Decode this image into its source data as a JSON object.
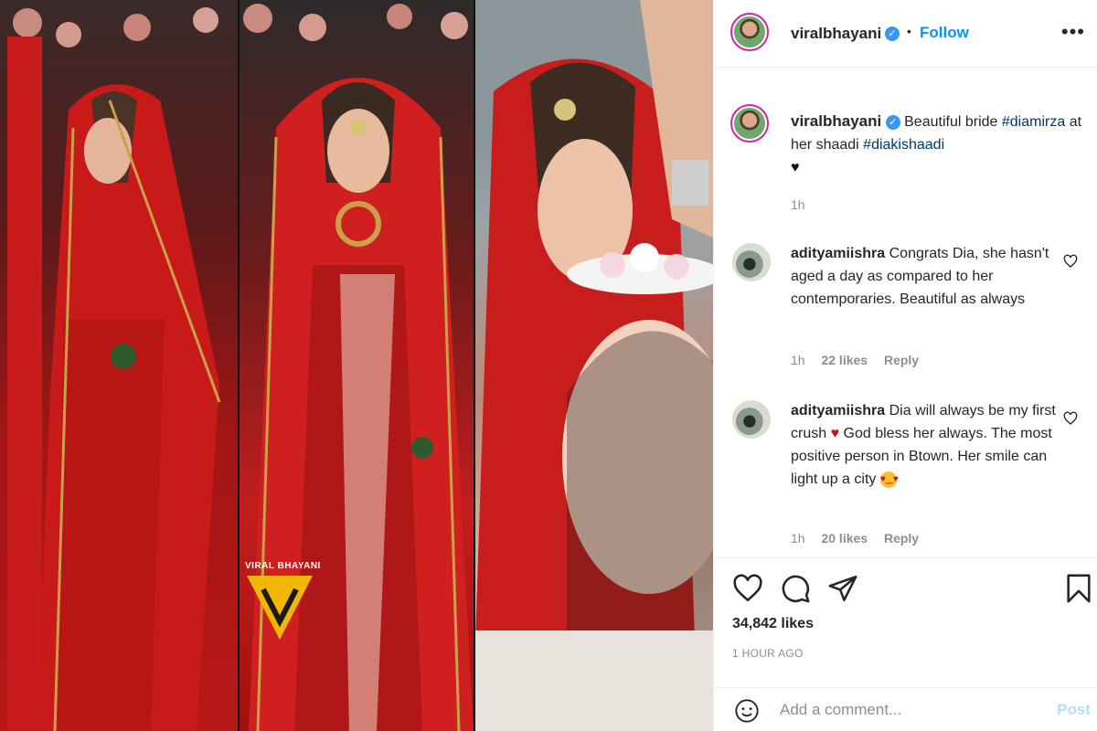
{
  "post": {
    "username": "viralbhayani",
    "follow_label": "Follow",
    "separator": "•",
    "more_label": "•••"
  },
  "caption": {
    "username": "viralbhayani",
    "text_before": "Beautiful bride",
    "hashtag1": "#diamirza",
    "text_middle": "at her shaadi",
    "hashtag2": "#diakishaadi",
    "emoji": "♥",
    "time": "1h"
  },
  "comments": [
    {
      "username": "adityamiishra",
      "text": "Congrats Dia, she hasn't aged a day as compared to her contemporaries. Beautiful as always",
      "time": "1h",
      "likes": "22 likes",
      "reply": "Reply"
    },
    {
      "username": "adityamiishra",
      "text_a": "Dia will always be my first crush",
      "emoji_a": "♥",
      "text_b": "God bless her always. The most positive person in Btown. Her smile can light up a city",
      "emoji_b": "♥‿♥",
      "time": "1h",
      "likes": "20 likes",
      "reply": "Reply"
    }
  ],
  "stats": {
    "likes": "34,842 likes",
    "posted": "1 HOUR AGO"
  },
  "comment_box": {
    "placeholder": "Add a comment...",
    "post_label": "Post"
  },
  "watermark": "VIRAL BHAYANI",
  "colors": {
    "accent": "#0095f6",
    "verified": "#3897f0",
    "hashtag": "#00376b",
    "meta": "#8e8e8e",
    "post_disabled": "#b2dffc"
  },
  "icons": [
    "verified-icon",
    "more-icon",
    "heart-icon",
    "comment-icon",
    "share-icon",
    "bookmark-icon",
    "smile-icon"
  ]
}
